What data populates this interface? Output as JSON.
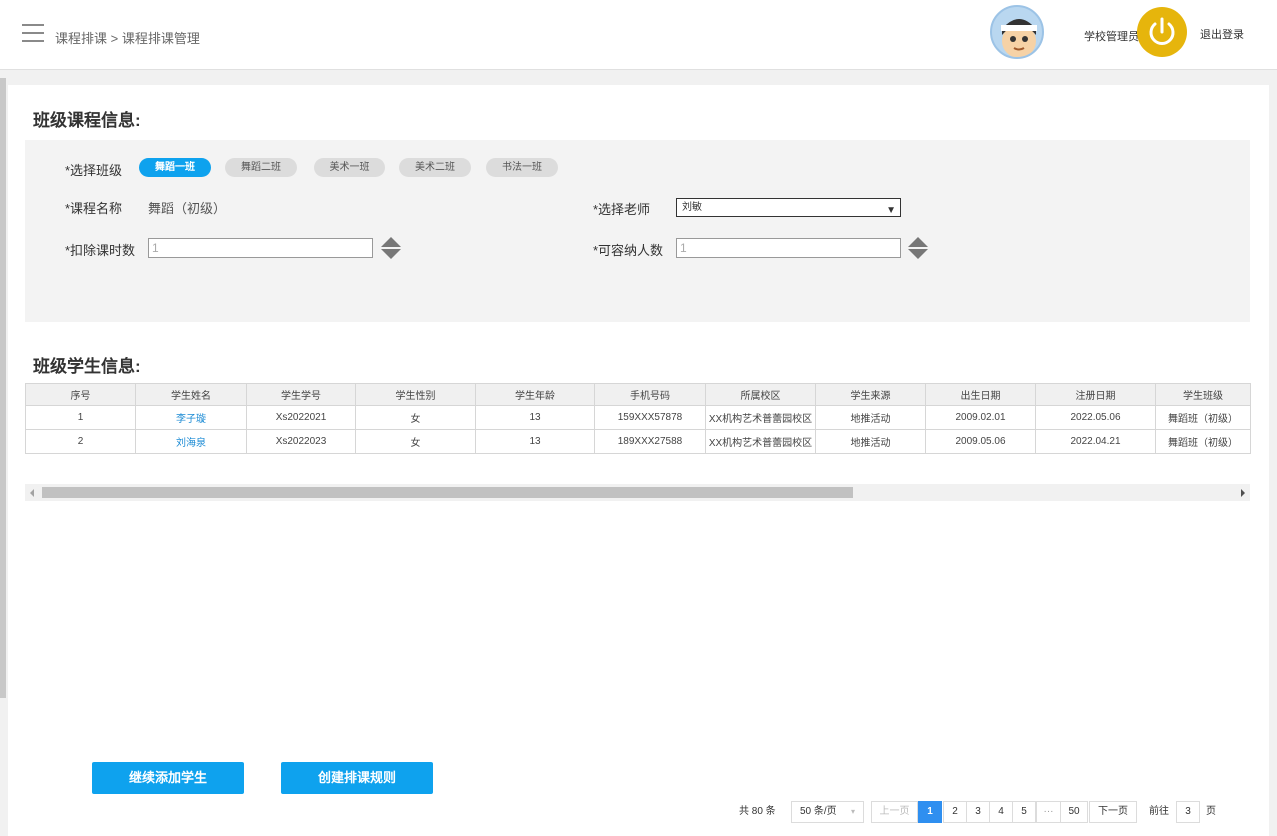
{
  "header": {
    "breadcrumb": "课程排课 > 课程排课管理",
    "user_name": "学校管理员",
    "logout_label": "退出登录"
  },
  "course_section": {
    "title": "班级课程信息:",
    "class_label": "*选择班级",
    "classes": [
      "舞蹈一班",
      "舞蹈二班",
      "美术一班",
      "美术二班",
      "书法一班"
    ],
    "selected_class": "舞蹈一班",
    "course_name_label": "*课程名称",
    "course_name_value": "舞蹈（初级）",
    "teacher_label": "*选择老师",
    "teacher_value": "刘敏",
    "deduct_label": "*扣除课时数",
    "deduct_placeholder": "1",
    "capacity_label": "*可容纳人数",
    "capacity_placeholder": "1"
  },
  "student_section": {
    "title": "班级学生信息:",
    "columns": [
      "序号",
      "学生姓名",
      "学生学号",
      "学生性别",
      "学生年龄",
      "手机号码",
      "所属校区",
      "学生来源",
      "出生日期",
      "注册日期",
      "学生班级"
    ],
    "rows": [
      [
        "1",
        "李子璇",
        "Xs2022021",
        "女",
        "13",
        "159XXX57878",
        "XX机构艺术普蕾园校区",
        "地推活动",
        "2009.02.01",
        "2022.05.06",
        "舞蹈班（初级）"
      ],
      [
        "2",
        "刘海泉",
        "Xs2022023",
        "女",
        "13",
        "189XXX27588",
        "XX机构艺术普蕾园校区",
        "地推活动",
        "2009.05.06",
        "2022.04.21",
        "舞蹈班（初级）"
      ]
    ]
  },
  "actions": {
    "add_student": "继续添加学生",
    "create_rule": "创建排课规则"
  },
  "pagination": {
    "total": "共 80 条",
    "page_size": "50 条/页",
    "prev": "上一页",
    "pages": [
      "1",
      "2",
      "3",
      "4",
      "5",
      "···",
      "50"
    ],
    "current": "1",
    "next": "下一页",
    "goto_label": "前往",
    "goto_value": "3",
    "page_unit": "页"
  },
  "colors": {
    "accent": "#0ea2ee",
    "power": "#e6b50c",
    "page_active": "#2f8ff0",
    "link": "#1a8ad4"
  }
}
